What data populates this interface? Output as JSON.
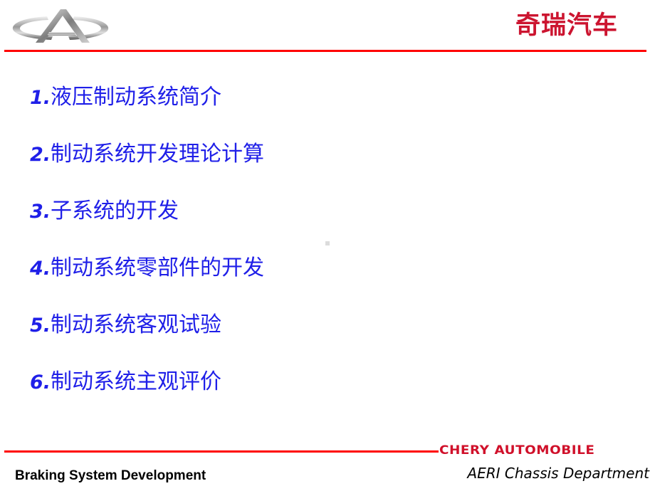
{
  "header": {
    "logo_icon": "chery-emblem-icon",
    "brand_cn": "奇瑞汽车"
  },
  "agenda": {
    "items": [
      {
        "num": "1.",
        "text": "液压制动系统简介"
      },
      {
        "num": "2.",
        "text": "制动系统开发理论计算"
      },
      {
        "num": "3.",
        "text": "子系统的开发"
      },
      {
        "num": "4.",
        "text": "制动系统零部件的开发"
      },
      {
        "num": "5.",
        "text": "制动系统客观试验"
      },
      {
        "num": "6.",
        "text": "制动系统主观评价"
      }
    ]
  },
  "footer": {
    "brand_en": "CHERY AUTOMOBILE",
    "left_title": "Braking System Development",
    "right_title": "AERI Chassis Department"
  },
  "colors": {
    "accent_red": "#ff0000",
    "brand_red": "#cc1530",
    "text_blue": "#1f1fe8"
  }
}
